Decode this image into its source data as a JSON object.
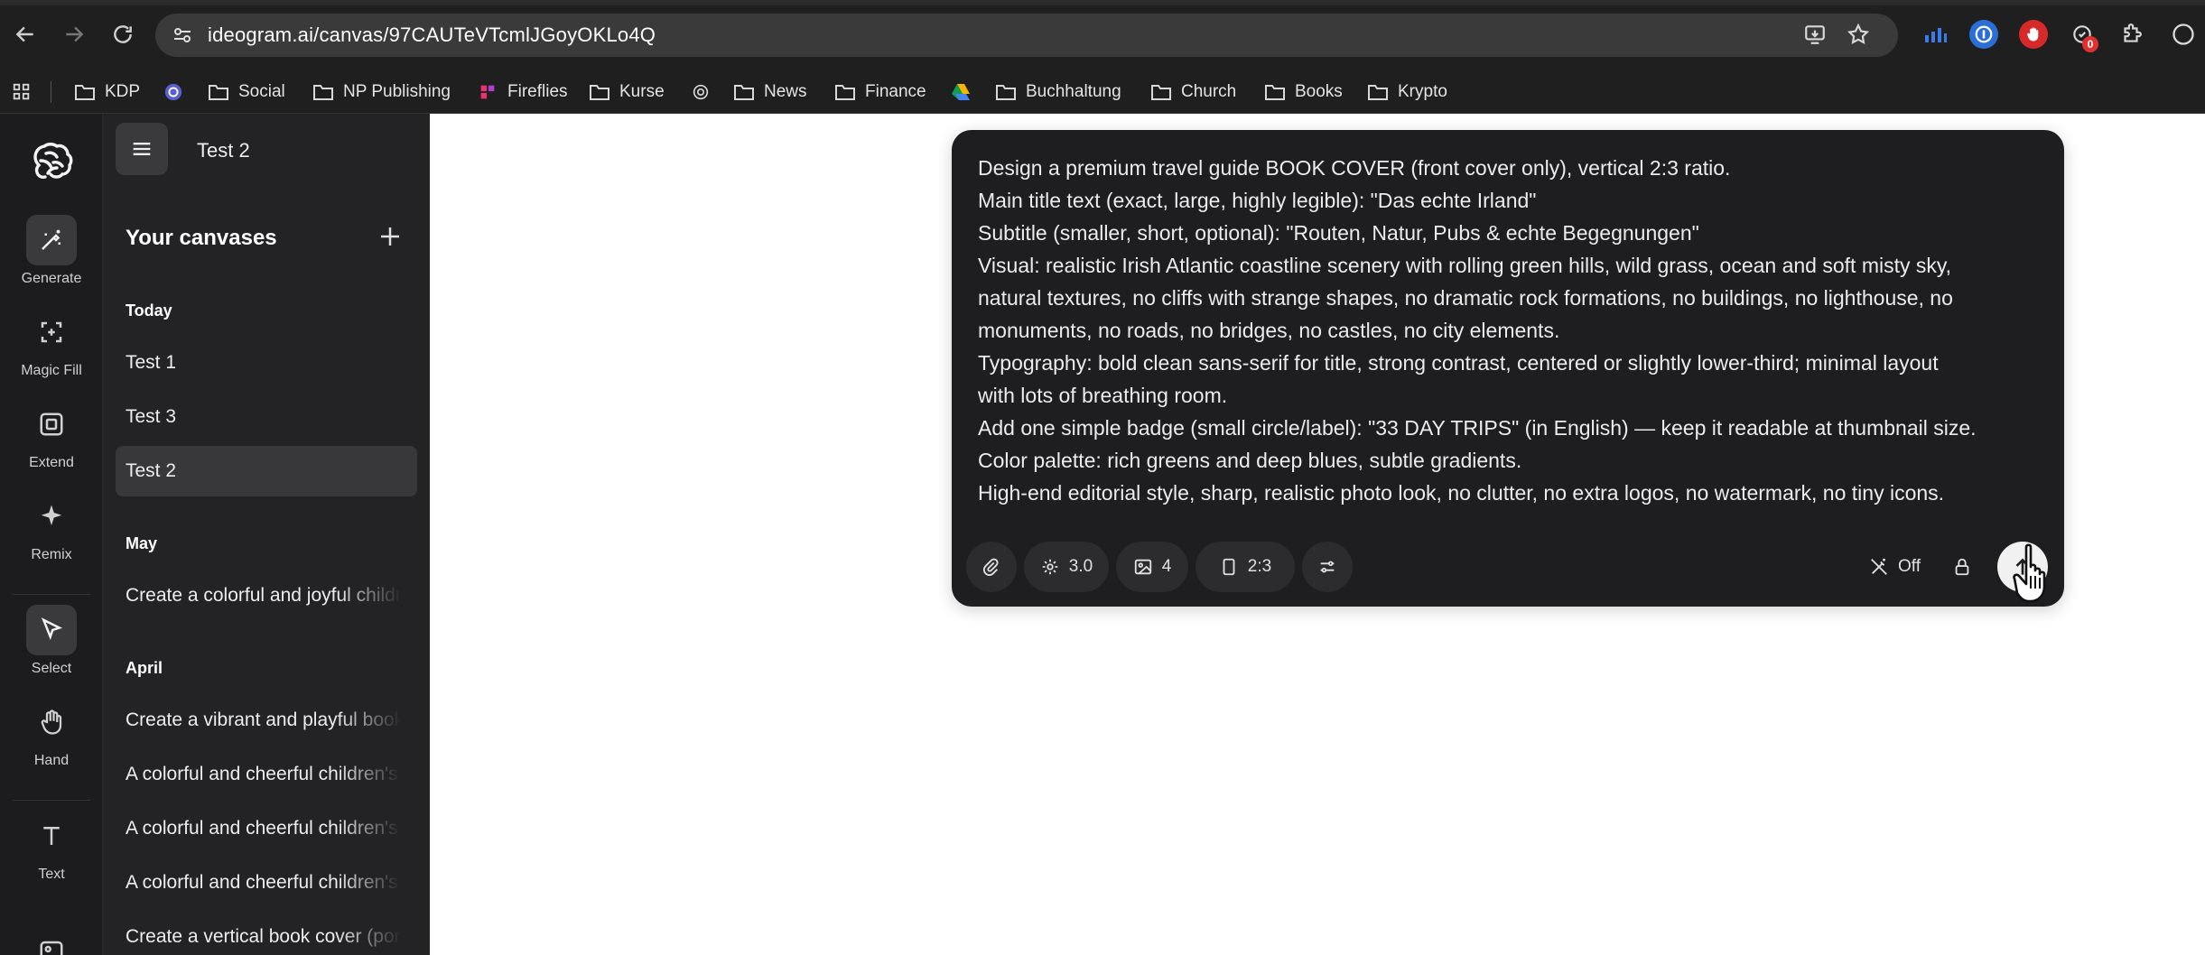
{
  "browser": {
    "url": "ideogram.ai/canvas/97CAUTeVTcmlJGoyOKLo4Q",
    "extension_badge": "0"
  },
  "bookmarks": [
    {
      "label": "KDP",
      "icon": "folder-icon"
    },
    {
      "label": "Social",
      "icon": "folder-icon"
    },
    {
      "label": "NP Publishing",
      "icon": "folder-icon"
    },
    {
      "label": "Fireflies",
      "icon": "fireflies-icon"
    },
    {
      "label": "Kurse",
      "icon": "folder-icon"
    },
    {
      "label": "News",
      "icon": "folder-icon"
    },
    {
      "label": "Finance",
      "icon": "folder-icon"
    },
    {
      "label": "Buchhaltung",
      "icon": "folder-icon"
    },
    {
      "label": "Church",
      "icon": "folder-icon"
    },
    {
      "label": "Books",
      "icon": "folder-icon"
    },
    {
      "label": "Krypto",
      "icon": "folder-icon"
    }
  ],
  "rail": {
    "generate": "Generate",
    "magic_fill": "Magic Fill",
    "extend": "Extend",
    "remix": "Remix",
    "select": "Select",
    "hand": "Hand",
    "text": "Text"
  },
  "panel": {
    "canvas_title": "Test 2",
    "heading": "Your canvases",
    "groups": {
      "today": "Today",
      "may": "May",
      "april": "April"
    },
    "items": {
      "today": [
        "Test 1",
        "Test 3",
        "Test 2"
      ],
      "may": [
        "Create a colorful and joyful childre"
      ],
      "april": [
        "Create a vibrant and playful book c",
        "A colorful and cheerful children's b",
        "A colorful and cheerful children's b",
        "A colorful and cheerful children's b",
        "Create a vertical book cover (portr"
      ]
    }
  },
  "prompt": {
    "lines": [
      "Design a premium travel guide BOOK COVER (front cover only), vertical 2:3 ratio.",
      "Main title text (exact, large, highly legible): \"Das echte Irland\"",
      "Subtitle (smaller, short, optional): \"Routen, Natur, Pubs & echte Begegnungen\"",
      "Visual: realistic Irish Atlantic coastline scenery with rolling green hills, wild grass, ocean and soft misty sky,",
      "natural textures, no cliffs with strange shapes, no dramatic rock formations, no buildings, no lighthouse, no",
      "monuments, no roads, no bridges, no castles, no city elements.",
      "Typography: bold clean sans-serif for title, strong contrast, centered or slightly lower-third; minimal layout",
      "with lots of breathing room.",
      "Add one simple badge (small circle/label): \"33 DAY TRIPS\" (in English) — keep it readable at thumbnail size.",
      "Color palette: rich greens and deep blues, subtle gradients.",
      "High-end editorial style, sharp, realistic photo look, no clutter, no extra logos, no watermark, no tiny icons."
    ],
    "toolbar": {
      "model": "3.0",
      "image_count": "4",
      "aspect_ratio": "2:3",
      "magic_prompt": "Off"
    }
  }
}
